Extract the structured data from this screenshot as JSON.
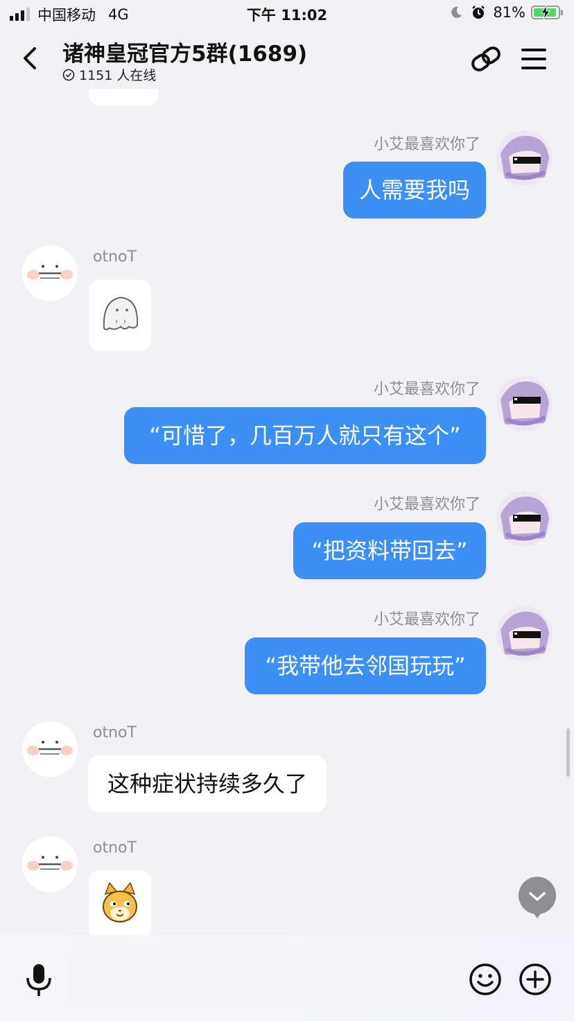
{
  "status_bar": {
    "carrier": "中国移动",
    "network": "4G",
    "time": "下午 11:02",
    "battery": "81%"
  },
  "header": {
    "title": "诸神皇冠官方5群(1689)",
    "online": "1151 人在线"
  },
  "messages": [
    {
      "sender": "小艾最喜欢你了",
      "text": "人需要我吗"
    },
    {
      "sender": "otnoT",
      "sticker": "ghost-sticker"
    },
    {
      "sender": "小艾最喜欢你了",
      "text": "“可惜了，几百万人就只有这个”"
    },
    {
      "sender": "小艾最喜欢你了",
      "text": "“把资料带回去”"
    },
    {
      "sender": "小艾最喜欢你了",
      "text": "“我带他去邻国玩玩”"
    },
    {
      "sender": "otnoT",
      "text": "这种症状持续多久了"
    },
    {
      "sender": "otnoT",
      "sticker": "cat-face-sticker"
    }
  ],
  "input": {
    "placeholder": ""
  },
  "colors": {
    "accent": "#3b8ff5",
    "background": "#f2f2f5",
    "bubble_in": "#ffffff",
    "sender_text": "#8e8e93"
  }
}
